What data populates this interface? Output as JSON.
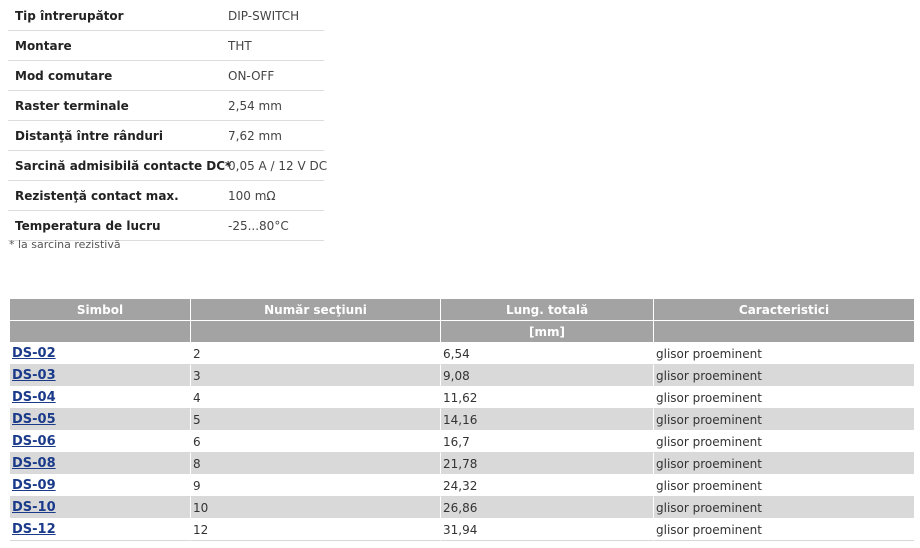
{
  "specs": [
    {
      "label": "Tip întrerupător",
      "value": "DIP-SWITCH"
    },
    {
      "label": "Montare",
      "value": "THT"
    },
    {
      "label": "Mod comutare",
      "value": "ON-OFF"
    },
    {
      "label": "Raster terminale",
      "value": "2,54 mm"
    },
    {
      "label": "Distanţă între rânduri",
      "value": "7,62 mm"
    },
    {
      "label": "Sarcină admisibilă contacte DC*",
      "value": "0,05 A / 12 V DC"
    },
    {
      "label": "Rezistenţă contact max.",
      "value": "100 mΩ"
    },
    {
      "label": "Temperatura de lucru",
      "value": "-25...80°C"
    }
  ],
  "footnote": "* la sarcina rezistivă",
  "table": {
    "headers": [
      "Simbol",
      "Număr secţiuni",
      "Lung. totală",
      "Caracteristici"
    ],
    "subheaders": [
      "",
      "",
      "[mm]",
      ""
    ],
    "rows": [
      {
        "symbol": "DS-02",
        "sections": "2",
        "length": "6,54",
        "feature": "glisor proeminent"
      },
      {
        "symbol": "DS-03",
        "sections": "3",
        "length": "9,08",
        "feature": "glisor proeminent"
      },
      {
        "symbol": "DS-04",
        "sections": "4",
        "length": "11,62",
        "feature": "glisor proeminent"
      },
      {
        "symbol": "DS-05",
        "sections": "5",
        "length": "14,16",
        "feature": "glisor proeminent"
      },
      {
        "symbol": "DS-06",
        "sections": "6",
        "length": "16,7",
        "feature": "glisor proeminent"
      },
      {
        "symbol": "DS-08",
        "sections": "8",
        "length": "21,78",
        "feature": "glisor proeminent"
      },
      {
        "symbol": "DS-09",
        "sections": "9",
        "length": "24,32",
        "feature": "glisor proeminent"
      },
      {
        "symbol": "DS-10",
        "sections": "10",
        "length": "26,86",
        "feature": "glisor proeminent"
      },
      {
        "symbol": "DS-12",
        "sections": "12",
        "length": "31,94",
        "feature": "glisor proeminent"
      }
    ]
  },
  "colors": {
    "header_bg": "#a3a3a3",
    "alt_row_bg": "#d9d9d9",
    "link": "#1a3a8a"
  }
}
